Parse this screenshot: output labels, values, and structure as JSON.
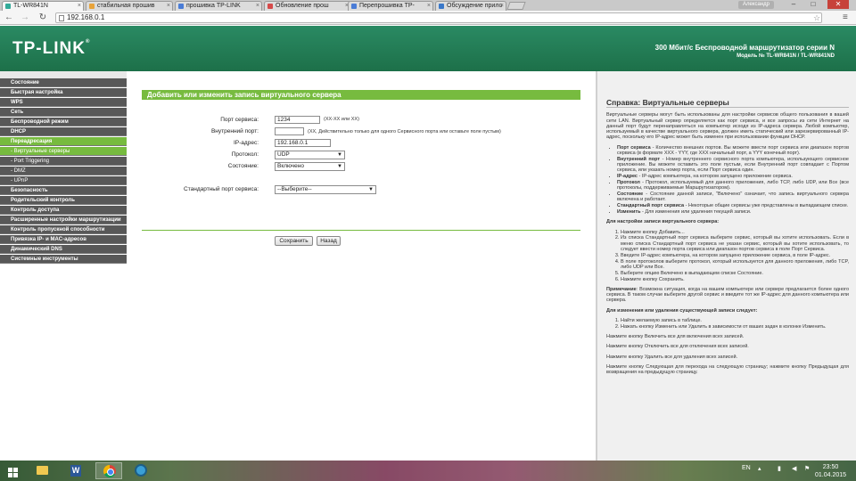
{
  "browser": {
    "tabs": [
      {
        "title": "TL-WR841N",
        "active": true
      },
      {
        "title": "стабильная прошив",
        "active": false
      },
      {
        "title": "прошивка TP-LINK",
        "active": false
      },
      {
        "title": "Обновление прош",
        "active": false
      },
      {
        "title": "Перепрошивка TP-",
        "active": false
      },
      {
        "title": "Обсуждение прило",
        "active": false
      }
    ],
    "profile": "Александр",
    "url": "192.168.0.1",
    "window_controls": {
      "minimize": "–",
      "maximize": "□",
      "close": "✕"
    },
    "nav_icons": {
      "back": "back-icon",
      "forward": "forward-icon",
      "reload": "reload-icon"
    }
  },
  "header": {
    "logo": "TP-LINK",
    "title": "300 Мбит/с Беспроводной маршрутизатор серии N",
    "model": "Модель № TL-WR841N / TL-WR841ND",
    "brand_color": "#1f7a4f"
  },
  "sidebar": {
    "items": [
      {
        "label": "Состояние",
        "type": "item"
      },
      {
        "label": "Быстрая настройка",
        "type": "item"
      },
      {
        "label": "WPS",
        "type": "item"
      },
      {
        "label": "Сеть",
        "type": "item"
      },
      {
        "label": "Беспроводной режим",
        "type": "item"
      },
      {
        "label": "DHCP",
        "type": "item"
      },
      {
        "label": "Переадресация",
        "type": "active"
      },
      {
        "label": "- Виртуальные серверы",
        "type": "sub-active"
      },
      {
        "label": "- Port Triggering",
        "type": "sub"
      },
      {
        "label": "- DMZ",
        "type": "sub"
      },
      {
        "label": "- UPnP",
        "type": "sub"
      },
      {
        "label": "Безопасность",
        "type": "item"
      },
      {
        "label": "Родительский контроль",
        "type": "item"
      },
      {
        "label": "Контроль доступа",
        "type": "item"
      },
      {
        "label": "Расширенные настройки маршрутизации",
        "type": "item"
      },
      {
        "label": "Контроль пропускной способности",
        "type": "item"
      },
      {
        "label": "Привязка IP- и MAC-адресов",
        "type": "item"
      },
      {
        "label": "Динамический DNS",
        "type": "item"
      },
      {
        "label": "Системные инструменты",
        "type": "item"
      }
    ],
    "accent_color": "#77bb3f"
  },
  "form": {
    "section_title": "Добавить или изменить запись виртуального сервера",
    "service_port_label": "Порт сервиса:",
    "service_port_value": "1234",
    "service_port_hint": "(XX-XX или XX)",
    "internal_port_label": "Внутренний порт:",
    "internal_port_value": "",
    "internal_port_hint": "(XX, Действительно только для одного Сервисного порта или оставьте поле пустым)",
    "ip_label": "IP-адрес:",
    "ip_value": "192.168.0.1",
    "protocol_label": "Протокол:",
    "protocol_value": "UDP",
    "status_label": "Состояние:",
    "status_value": "Включено",
    "std_port_label": "Стандартный порт сервиса:",
    "std_port_value": "--Выберите--",
    "save_button": "Сохранить",
    "back_button": "Назад"
  },
  "help": {
    "title": "Справка: Виртуальные серверы",
    "intro": "Виртуальные серверы могут быть использованы для настройки сервисов общего пользования в вашей сети LAN. Виртуальный сервер определяется как порт сервиса, и все запросы из сети Интернет на данный порт будут перенаправляться на компьютер исходя из IP-адреса сервера. Любой компьютер, используемый в качестве виртуального сервера, должен иметь статический или зарезервированный IP-адрес, поскольку его IP-адрес может быть изменен при использовании функции DHCP.",
    "bullets": [
      {
        "term": "Порт сервиса",
        "text": " - Количество внешних портов. Вы можете ввести порт сервиса или диапазон портов сервиса (в формате XXX - YYY, где XXX начальный порт, а YYY конечный порт)."
      },
      {
        "term": "Внутренний порт",
        "text": " - Номер внутреннего сервисного порта компьютера, использующего сервисное приложение. Вы можете оставить это поле пустым, если Внутренний порт совпадает с Портом сервиса, или указать номер порта, если Порт сервиса один."
      },
      {
        "term": "IP-адрес",
        "text": " - IP-адрес компьютера, на котором запущено приложение сервиса."
      },
      {
        "term": "Протокол",
        "text": " - Протокол, используемый для данного приложения, либо TCP, либо UDP, или Все (все протоколы, поддерживаемые Маршрутизатором)."
      },
      {
        "term": "Состояние",
        "text": " - Состояние данной записи, \"Включено\" означает, что запись виртуального сервера включена и работает."
      },
      {
        "term": "Стандартный порт сервиса",
        "text": " - Некоторые общие сервисы уже представлены в выпадающем списке."
      },
      {
        "term": "Изменить",
        "text": " - Для изменения или удаления текущей записи."
      }
    ],
    "setup_title": "Для настройки записи виртуального сервера:",
    "setup_steps": [
      "Нажмите кнопку Добавить...",
      "Из списка Стандартный порт сервиса выберите сервис, который вы хотите использовать. Если в меню списка Стандартный порт сервиса не указан сервис, который вы хотите использовать, то следует ввести номер порта сервиса или диапазон портов сервиса в поле Порт Сервиса.",
      "Введите IP-адрес компьютера, на котором запущено приложение сервиса, в поле IP-адрес.",
      "В поле протоколов выберите протокол, который используется для данного приложения, либо TCP, либо UDP или Все.",
      "Выберите опцию Включено в выпадающем списке Состояние.",
      "Нажмите кнопку Сохранить."
    ],
    "note_term": "Примечание",
    "note_text": ": Возможна ситуация, когда на вашем компьютере или сервере предлагается более одного сервиса. В таком случае выберите другой сервис и введите тот же IP-адрес для данного компьютера или сервера.",
    "edit_title": "Для изменения или удаления существующей записи следует:",
    "edit_steps": [
      "Найти желаемую запись в таблице.",
      "Нажать кнопку Изменить или Удалить в зависимости от ваших задач в колонке Изменить."
    ],
    "enable_all": "Нажмите кнопку Включить все для включения всех записей.",
    "disable_all": "Нажмите кнопку Отключить все для отключения всех записей.",
    "delete_all": "Нажмите кнопку Удалить все для удаления всех записей.",
    "paging": "Нажмите кнопку Следующая для перехода на следующую страницу; нажмите кнопку Предыдущая для возвращения на предыдущую страницу."
  },
  "taskbar": {
    "apps": [
      {
        "name": "file-explorer-icon"
      },
      {
        "name": "word-icon",
        "glyph": "W"
      },
      {
        "name": "chrome-icon"
      },
      {
        "name": "app-icon"
      }
    ],
    "language": "EN",
    "time": "23:50",
    "date": "01.04.2015"
  }
}
